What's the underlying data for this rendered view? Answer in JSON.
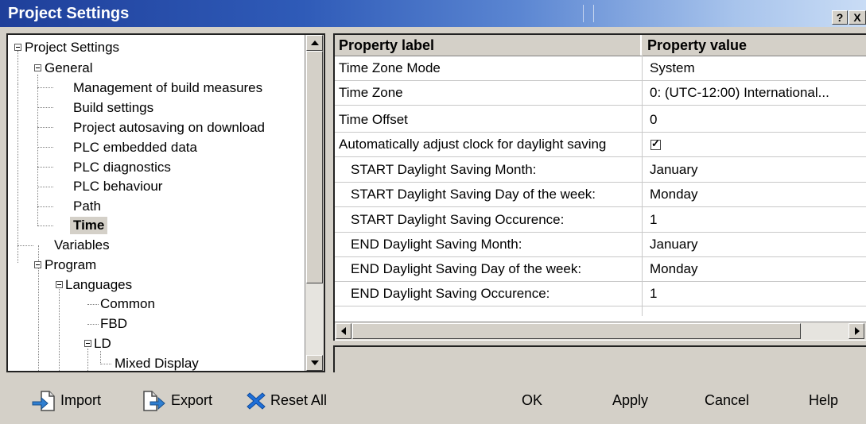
{
  "window": {
    "title": "Project Settings",
    "help_label": "?",
    "close_label": "X"
  },
  "tree": {
    "items": [
      {
        "label": "Project Settings"
      },
      {
        "label": "General"
      },
      {
        "label": "Management of build measures"
      },
      {
        "label": "Build settings"
      },
      {
        "label": "Project autosaving on download"
      },
      {
        "label": "PLC embedded data"
      },
      {
        "label": "PLC diagnostics"
      },
      {
        "label": "PLC behaviour"
      },
      {
        "label": "Path"
      },
      {
        "label": "Time",
        "selected": true
      },
      {
        "label": "Variables"
      },
      {
        "label": "Program"
      },
      {
        "label": "Languages"
      },
      {
        "label": "Common"
      },
      {
        "label": "FBD"
      },
      {
        "label": "LD"
      },
      {
        "label": "Mixed Display"
      }
    ]
  },
  "properties": {
    "header_label": "Property label",
    "header_value": "Property value",
    "rows": [
      {
        "label": "Time Zone Mode",
        "value": "System"
      },
      {
        "label": "Time Zone",
        "value": "0: (UTC-12:00) International..."
      },
      {
        "label": "Time Offset",
        "value": "0"
      },
      {
        "label": "Automatically adjust clock for daylight saving",
        "checked": true
      },
      {
        "label": "START Daylight Saving Month:",
        "value": "January"
      },
      {
        "label": "START Daylight Saving Day of the week:",
        "value": "Monday"
      },
      {
        "label": "START Daylight Saving Occurence:",
        "value": "1"
      },
      {
        "label": "END Daylight Saving Month:",
        "value": "January"
      },
      {
        "label": "END Daylight Saving Day of the week:",
        "value": "Monday"
      },
      {
        "label": "END Daylight Saving Occurence:",
        "value": "1"
      }
    ]
  },
  "footer": {
    "import_label": "Import",
    "export_label": "Export",
    "reset_label": "Reset All",
    "ok_label": "OK",
    "apply_label": "Apply",
    "cancel_label": "Cancel",
    "help_label": "Help"
  },
  "colors": {
    "title_start": "#1f3f9a",
    "title_end": "#c9dcf5",
    "dialog_bg": "#d4d0c8",
    "reset_icon": "#1e6fd9"
  }
}
